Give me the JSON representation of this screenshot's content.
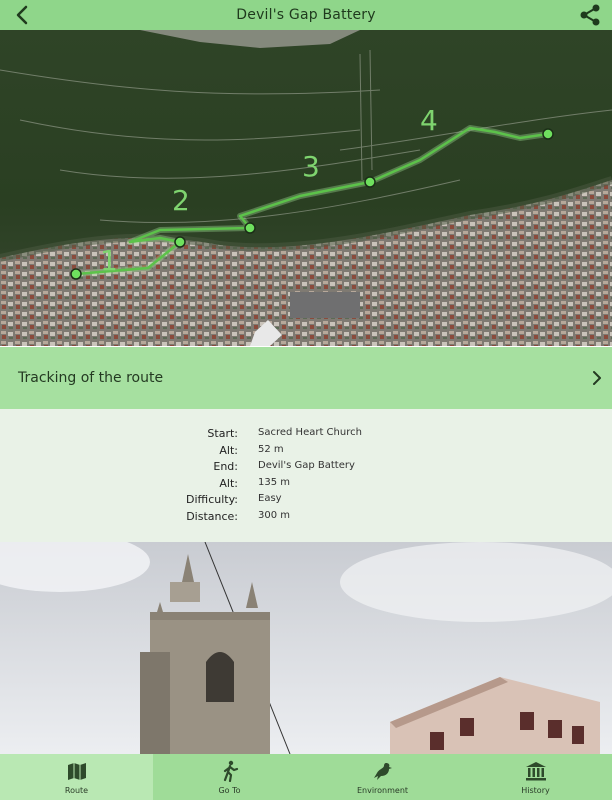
{
  "header": {
    "title": "Devil's Gap Battery",
    "back_icon": "chevron-left-icon",
    "share_icon": "share-icon"
  },
  "map": {
    "waypoint_labels": [
      "1",
      "2",
      "3",
      "4"
    ],
    "route_color": "#5cc24a"
  },
  "tracking": {
    "label": "Tracking of the route",
    "icon": "chevron-right-icon"
  },
  "route_info": {
    "start_label": "Start:",
    "start_value": "Sacred Heart Church",
    "alt1_label": "Alt:",
    "alt1_value": "52 m",
    "end_label": "End:",
    "end_value": "Devil's Gap Battery",
    "alt2_label": "Alt:",
    "alt2_value": "135 m",
    "difficulty_label": "Difficulty:",
    "difficulty_value": "Easy",
    "distance_label": "Distance:",
    "distance_value": "300 m"
  },
  "tabs": [
    {
      "label": "Route",
      "icon": "map-icon",
      "active": true
    },
    {
      "label": "Go To",
      "icon": "walking-icon",
      "active": false
    },
    {
      "label": "Environment",
      "icon": "bird-icon",
      "active": false
    },
    {
      "label": "History",
      "icon": "museum-icon",
      "active": false
    }
  ],
  "colors": {
    "bar_green": "#8fd68a",
    "tracking_green": "#a6e0a0",
    "info_bg": "#e9f2e7",
    "tab_active": "#b9e8b3"
  }
}
